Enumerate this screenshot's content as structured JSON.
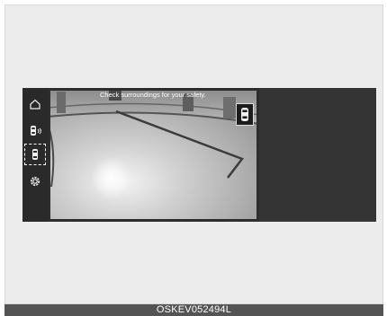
{
  "screen": {
    "message": "Check surroundings for your safety."
  },
  "sidebar": {
    "items": [
      {
        "name": "home",
        "icon": "home-icon"
      },
      {
        "name": "parking-sensor",
        "icon": "car-sound-icon"
      },
      {
        "name": "rear-view",
        "icon": "car-top-view-icon",
        "selected": true
      },
      {
        "name": "settings",
        "icon": "gear-icon"
      }
    ]
  },
  "caption": {
    "text": "OSKEV052494L"
  }
}
